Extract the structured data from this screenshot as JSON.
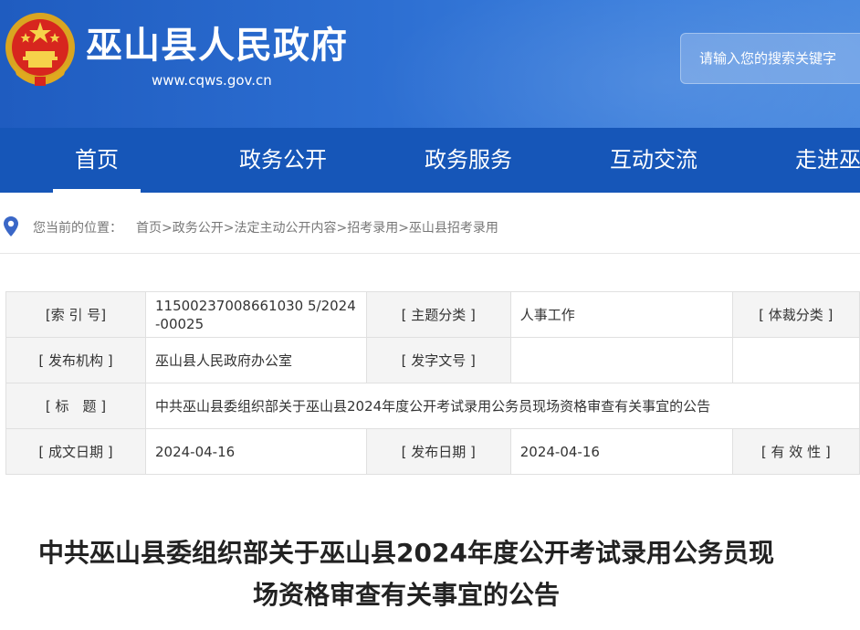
{
  "header": {
    "site_title": "巫山县人民政府",
    "site_url": "www.cqws.gov.cn",
    "emblem_icon": "national-emblem-icon",
    "search_placeholder": "请输入您的搜索关键字",
    "colors": {
      "header_blue": "#2d6fd2",
      "nav_blue": "#1656b8"
    }
  },
  "nav": {
    "items": [
      {
        "label": "首页",
        "active": true
      },
      {
        "label": "政务公开",
        "active": false
      },
      {
        "label": "政务服务",
        "active": false
      },
      {
        "label": "互动交流",
        "active": false
      },
      {
        "label": "走进巫山",
        "active": false
      }
    ]
  },
  "breadcrumb": {
    "icon": "location-pin-icon",
    "prefix": "您当前的位置：",
    "path": "首页>政务公开>法定主动公开内容>招考录用>巫山县招考录用"
  },
  "meta": {
    "index_label": "[索 引 号]",
    "index_value": "11500237008661030 5/2024-00025",
    "topic_label": "[ 主题分类 ]",
    "topic_value": "人事工作",
    "genre_label": "[ 体裁分类 ]",
    "org_label": "[ 发布机构 ]",
    "org_value": "巫山县人民政府办公室",
    "docno_label": "[ 发字文号 ]",
    "docno_value": "",
    "title_label": "[ 标　题 ]",
    "title_value": "中共巫山县委组织部关于巫山县2024年度公开考试录用公务员现场资格审查有关事宜的公告",
    "created_label": "[ 成文日期 ]",
    "created_value": "2024-04-16",
    "published_label": "[ 发布日期 ]",
    "published_value": "2024-04-16",
    "validity_label": "[ 有 效 性 ]"
  },
  "article": {
    "title_line1": "中共巫山县委组织部关于巫山县2024年度公开考试录用公务员现",
    "title_line2": "场资格审查有关事宜的公告"
  }
}
